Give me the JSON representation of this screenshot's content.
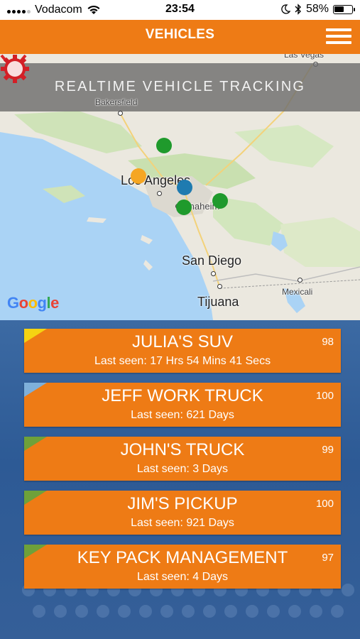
{
  "status_bar": {
    "carrier": "Vodacom",
    "time": "23:54",
    "battery_percent": "58%",
    "battery_level": 0.58
  },
  "header": {
    "title": "VEHICLES"
  },
  "map": {
    "banner": "REALTIME VEHICLE TRACKING",
    "places": {
      "bakersfield": "Bakersfield",
      "las_vegas": "Las Vegas",
      "los_angeles": "Los Angeles",
      "anaheim": "Anaheim",
      "san_diego": "San Diego",
      "tijuana": "Tijuana",
      "mexicali": "Mexicali"
    },
    "google_logo": "Google",
    "marker_colors": {
      "green": "#1f9a2c",
      "orange": "#f5a623",
      "blue": "#1f7bb0"
    }
  },
  "vehicles": [
    {
      "name": "JULIA'S SUV",
      "last_seen": "Last seen: 17 Hrs 54 Mins 41 Secs",
      "score": "98",
      "corner_color": "#f5d312"
    },
    {
      "name": "JEFF WORK TRUCK",
      "last_seen": "Last seen: 621 Days",
      "score": "100",
      "corner_color": "#7fb0da"
    },
    {
      "name": "JOHN'S TRUCK",
      "last_seen": "Last seen: 3 Days",
      "score": "99",
      "corner_color": "#6ea13a"
    },
    {
      "name": "JIM'S PICKUP",
      "last_seen": "Last seen: 921 Days",
      "score": "100",
      "corner_color": "#6ea13a"
    },
    {
      "name": "KEY PACK MANAGEMENT",
      "last_seen": "Last seen: 4 Days",
      "score": "97",
      "corner_color": "#6ea13a"
    }
  ]
}
